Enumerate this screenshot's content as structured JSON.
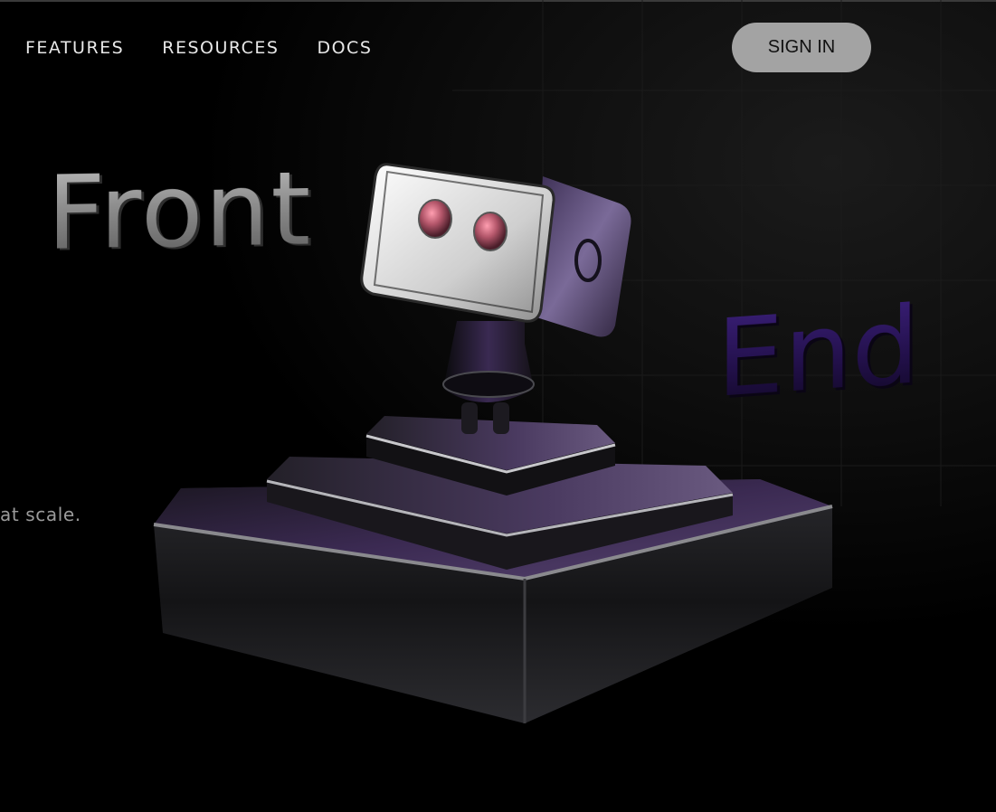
{
  "nav": {
    "links": [
      "FEATURES",
      "RESOURCES",
      "DOCS"
    ],
    "signin_label": "SIGN IN"
  },
  "hero": {
    "word_left": "Front",
    "word_right": "End",
    "tagline_fragment": "at scale."
  },
  "colors": {
    "background": "#000000",
    "signin_bg": "#a3a3a3",
    "front_text": "#8c8c8c",
    "end_text": "#2b1552",
    "robot_accent": "#4a3566"
  },
  "icons": {
    "robot": "robot-illustration"
  }
}
